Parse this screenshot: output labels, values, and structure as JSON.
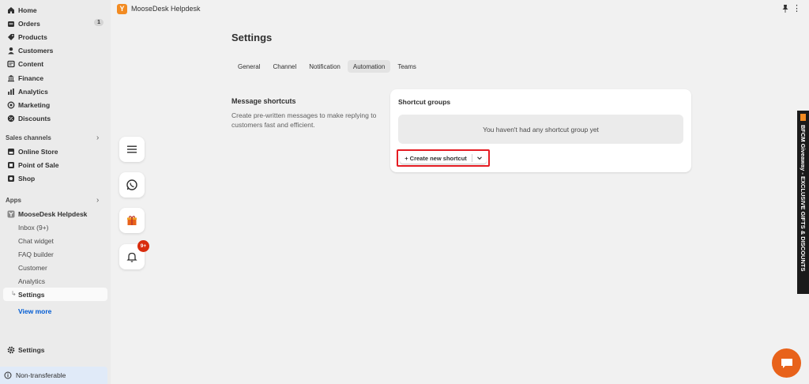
{
  "sidebar": {
    "main_items": [
      {
        "label": "Home",
        "icon": "home-icon"
      },
      {
        "label": "Orders",
        "icon": "orders-icon",
        "badge": "1"
      },
      {
        "label": "Products",
        "icon": "tag-icon"
      },
      {
        "label": "Customers",
        "icon": "person-icon"
      },
      {
        "label": "Content",
        "icon": "content-icon"
      },
      {
        "label": "Finance",
        "icon": "bank-icon"
      },
      {
        "label": "Analytics",
        "icon": "chart-icon"
      },
      {
        "label": "Marketing",
        "icon": "target-icon"
      },
      {
        "label": "Discounts",
        "icon": "discount-icon"
      }
    ],
    "sales_channels_label": "Sales channels",
    "sales_channels": [
      {
        "label": "Online Store",
        "icon": "store-icon"
      },
      {
        "label": "Point of Sale",
        "icon": "pos-icon"
      },
      {
        "label": "Shop",
        "icon": "shop-icon"
      }
    ],
    "apps_label": "Apps",
    "app_name": "MooseDesk Helpdesk",
    "app_sub_items": [
      "Inbox (9+)",
      "Chat widget",
      "FAQ builder",
      "Customer",
      "Analytics",
      "Settings"
    ],
    "view_more": "View more",
    "settings_label": "Settings",
    "non_transferable": "Non-transferable"
  },
  "topbar": {
    "app_title": "MooseDesk Helpdesk",
    "logo_letter": "Y"
  },
  "floating": {
    "bell_badge": "9+"
  },
  "main": {
    "page_title": "Settings",
    "tabs": [
      "General",
      "Channel",
      "Notification",
      "Automation",
      "Teams"
    ],
    "active_tab": "Automation",
    "section_title": "Message shortcuts",
    "section_desc": "Create pre-written messages to make replying to customers fast and efficient.",
    "card_title": "Shortcut groups",
    "empty_text": "You haven't had any shortcut group yet",
    "create_button": "+ Create new shortcut"
  },
  "promo": {
    "text": "BFCM Giveaway - EXCLUSIVE GIFTS & DISCOUNTS"
  },
  "colors": {
    "accent_blue": "#005bd3",
    "highlight_red": "#e51c23",
    "brand_orange": "#e8621a",
    "badge_red": "#d82c0d"
  }
}
